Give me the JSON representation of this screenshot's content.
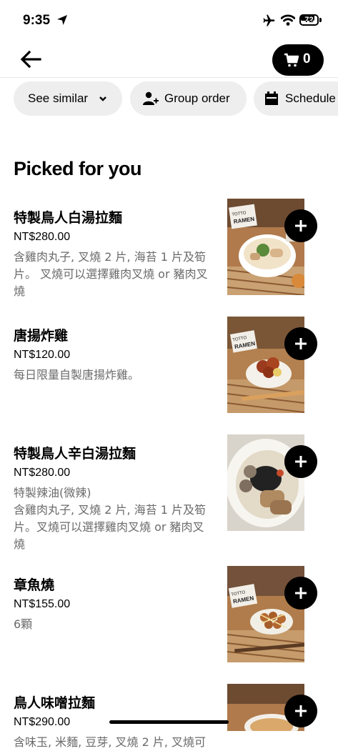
{
  "status": {
    "time": "9:35",
    "battery": "72"
  },
  "nav": {
    "cart_count": "0"
  },
  "chips": {
    "see_similar": "See similar",
    "group_order": "Group order",
    "schedule": "Schedule"
  },
  "section_title": "Picked for you",
  "items": [
    {
      "name": "特製鳥人白湯拉麵",
      "price": "NT$280.00",
      "desc": [
        "含雞肉丸子, 叉燒 2 片, 海苔 1 片及筍",
        "片。 叉燒可以選擇雞肉叉燒 or 豬肉叉",
        "燒"
      ]
    },
    {
      "name": "唐揚炸雞",
      "price": "NT$120.00",
      "desc": [
        "每日限量自製唐揚炸雞。"
      ]
    },
    {
      "name": "特製鳥人辛白湯拉麵",
      "price": "NT$280.00",
      "desc": [
        "特製辣油(微辣)",
        "含雞肉丸子, 叉燒 2 片, 海苔 1 片及筍",
        "片。叉燒可以選擇雞肉叉燒 or 豬肉叉",
        "燒"
      ]
    },
    {
      "name": "章魚燒",
      "price": "NT$155.00",
      "desc": [
        "6顆"
      ]
    },
    {
      "name": "鳥人味噌拉麵",
      "price": "NT$290.00",
      "desc": [
        "含味玉, 米麵, 豆芽, 叉燒 2 片, 叉燒可"
      ]
    }
  ],
  "image_labels": {
    "shop_sign": "TOTTO RAMEN"
  },
  "colors": {
    "accent": "#000000",
    "chip_bg": "#eeeeee",
    "muted_text": "#6b6b6b"
  }
}
